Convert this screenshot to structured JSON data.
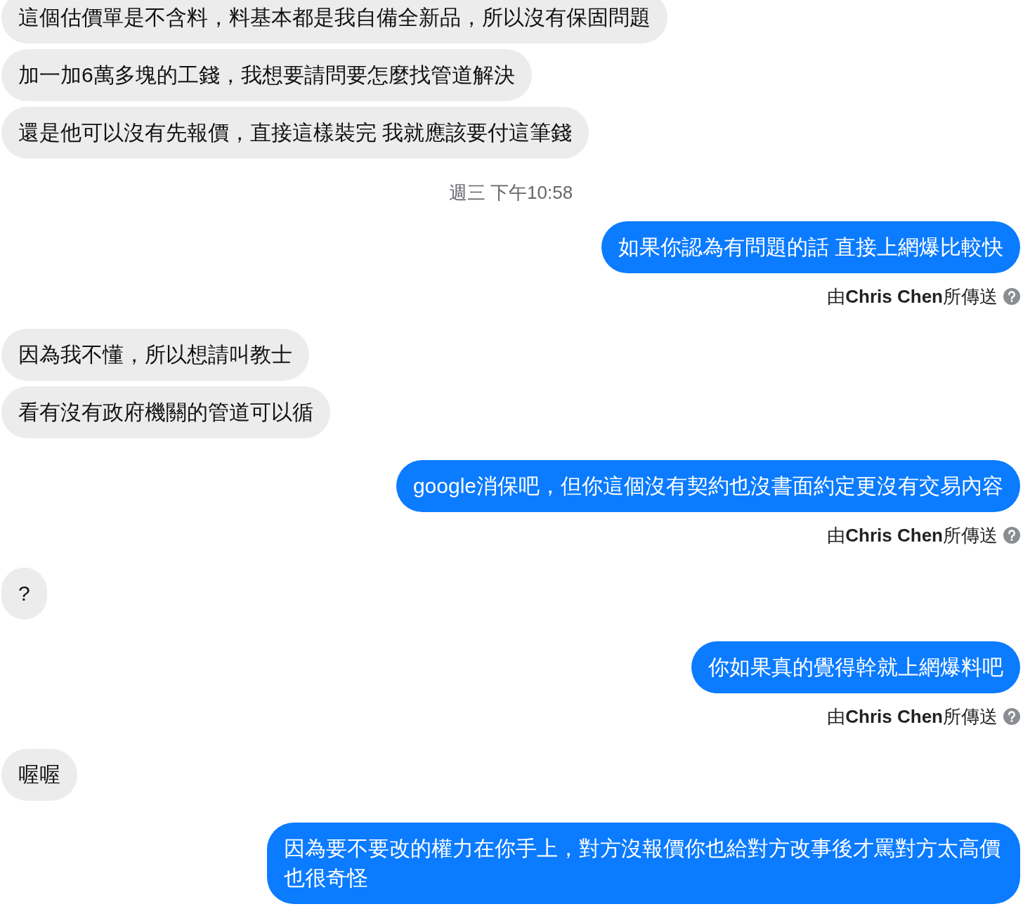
{
  "messages": [
    {
      "kind": "received",
      "text": "這個估價單是不含料，料基本都是我自備全新品，所以沒有保固問題"
    },
    {
      "kind": "received",
      "text": "加一加6萬多塊的工錢，我想要請問要怎麼找管道解決"
    },
    {
      "kind": "received",
      "text": "還是他可以沒有先報價，直接這樣裝完 我就應該要付這筆錢"
    },
    {
      "kind": "timestamp",
      "text": "週三 下午10:58"
    },
    {
      "kind": "sent",
      "text": "如果你認為有問題的話 直接上網爆比較快"
    },
    {
      "kind": "sender_note",
      "text": "由**Chris Chen**所傳送"
    },
    {
      "kind": "received",
      "text": "因為我不懂，所以想請叫教士"
    },
    {
      "kind": "received",
      "text": "看有沒有政府機關的管道可以循"
    },
    {
      "kind": "sent",
      "text": "google消保吧，但你這個沒有契約也沒書面約定更沒有交易內容"
    },
    {
      "kind": "sender_note",
      "text": "由**Chris Chen**所傳送"
    },
    {
      "kind": "received",
      "text": "?"
    },
    {
      "kind": "sent",
      "text": "你如果真的覺得幹就上網爆料吧"
    },
    {
      "kind": "sender_note",
      "text": "由**Chris Chen**所傳送"
    },
    {
      "kind": "received",
      "text": "喔喔"
    },
    {
      "kind": "sent",
      "text": "因為要不要改的權力在你手上，對方沒報價你也給對方改事後才罵對方太高價也很奇怪"
    }
  ]
}
